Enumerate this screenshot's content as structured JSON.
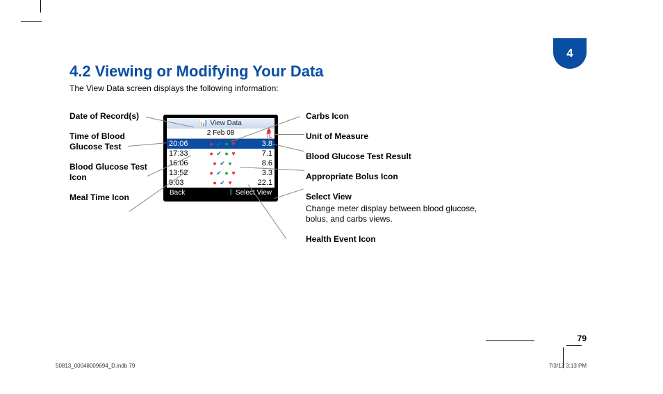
{
  "chapter": "4",
  "heading": "4.2 Viewing or Modifying Your Data",
  "intro": "The View Data screen displays the following information:",
  "left_callouts": [
    "Date of Record(s)",
    "Time of Blood Glucose Test",
    "Blood Glucose Test Icon",
    "Meal Time Icon"
  ],
  "right_callouts": [
    {
      "title": "Carbs Icon"
    },
    {
      "title": "Unit of Measure"
    },
    {
      "title": "Blood Glucose Test Result"
    },
    {
      "title": "Appropriate Bolus Icon"
    },
    {
      "title": "Select View",
      "desc": "Change meter display between blood glucose, bolus, and carbs views."
    },
    {
      "title": "Health Event Icon"
    }
  ],
  "meter": {
    "title": "View Data",
    "date": "2 Feb 08",
    "uom": "7L",
    "rows": [
      {
        "time": "20:06",
        "val": "3.8",
        "selected": true
      },
      {
        "time": "17:33",
        "val": "7.1",
        "selected": false
      },
      {
        "time": "16:06",
        "val": "8.6",
        "selected": false
      },
      {
        "time": "13:52",
        "val": "3.3",
        "selected": false
      },
      {
        "time": "9:03",
        "val": "22.1",
        "selected": false
      }
    ],
    "footer_left": "Back",
    "footer_right": "Select View"
  },
  "page_number": "79",
  "footer_left": "50813_00048009694_D.indb   79",
  "footer_right": "7/3/12   3:13 PM"
}
